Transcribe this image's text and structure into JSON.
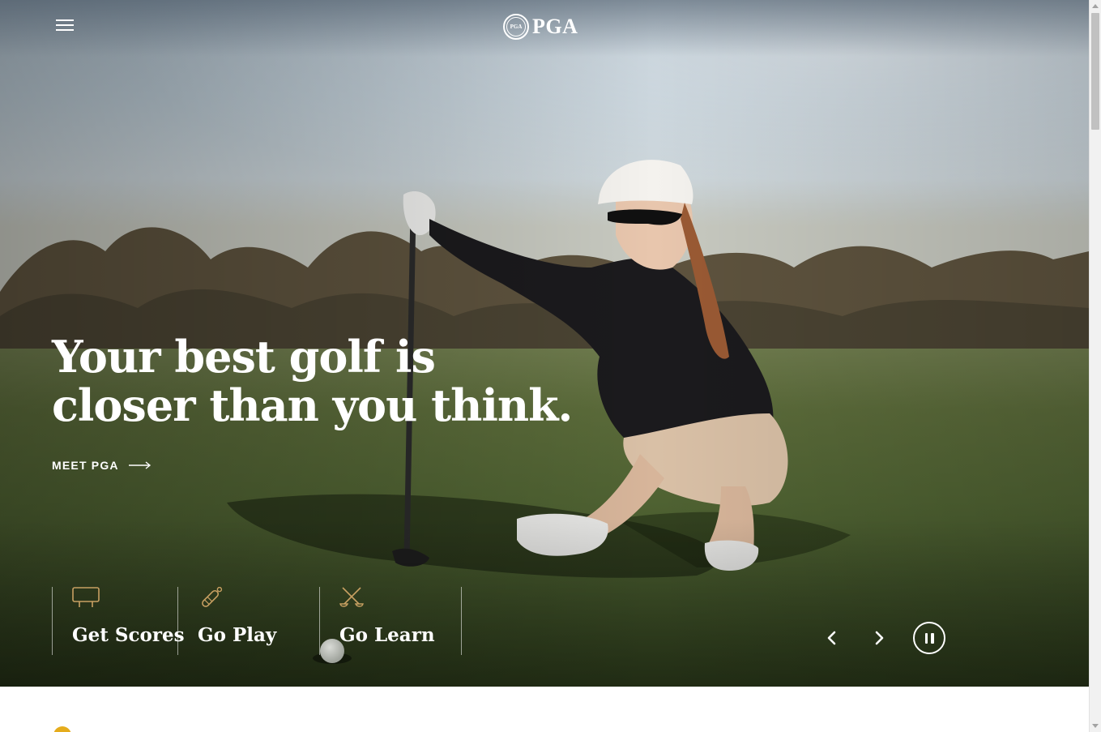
{
  "header": {
    "menu_icon": "hamburger-menu-icon",
    "logo_text": "PGA",
    "logo_seal_text": "PGA"
  },
  "hero": {
    "headline": "Your best golf is closer than you think.",
    "cta_label": "MEET PGA",
    "cta_icon": "arrow-right-icon"
  },
  "quick_links": [
    {
      "label": "Get Scores",
      "icon": "scoreboard-icon"
    },
    {
      "label": "Go Play",
      "icon": "golf-tee-icon"
    },
    {
      "label": "Go Learn",
      "icon": "crossed-clubs-icon"
    }
  ],
  "carousel": {
    "prev_icon": "chevron-left-icon",
    "next_icon": "chevron-right-icon",
    "pause_icon": "pause-icon"
  },
  "colors": {
    "accent": "#c8a062",
    "white": "#ffffff",
    "yellow_dot": "#e5ac1c"
  }
}
